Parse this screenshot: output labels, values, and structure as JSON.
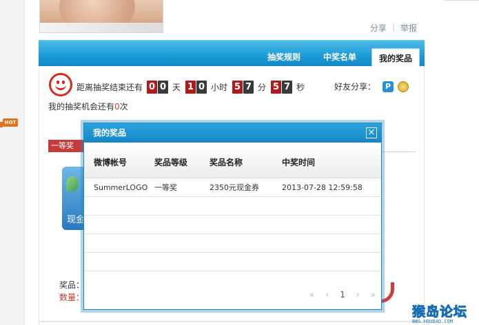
{
  "top_links": {
    "share": "分享",
    "report": "举报"
  },
  "tabs": [
    {
      "label": "抽奖规则"
    },
    {
      "label": "中奖名单"
    },
    {
      "label": "我的奖品"
    }
  ],
  "countdown": {
    "prefix": "距离抽奖结束还有",
    "days": [
      "0",
      "0"
    ],
    "days_unit": "天",
    "hours": [
      "1",
      "0"
    ],
    "hours_unit": "小时",
    "minutes": [
      "5",
      "7"
    ],
    "minutes_unit": "分",
    "seconds": [
      "5",
      "7"
    ],
    "seconds_unit": "秒"
  },
  "share": {
    "label": "好友分享：",
    "icon_p": "P"
  },
  "chance": {
    "prefix": "我的抽奖机会还有",
    "count": "0",
    "suffix": "次"
  },
  "hot_badge": "HOT",
  "prize": {
    "tag": "一等奖",
    "card_text": "现金",
    "label_prize": "奖品：",
    "label_quantity": "数量："
  },
  "modal": {
    "title": "我的奖品",
    "close": "×",
    "columns": [
      "微博帐号",
      "奖品等级",
      "奖品名称",
      "中奖时间"
    ],
    "rows": [
      {
        "account": "SummerLOGO",
        "level": "一等奖",
        "name": "2350元现金券",
        "time": "2013-07-28 12:59:58"
      }
    ],
    "pager": {
      "first": "«",
      "prev": "‹",
      "page": "1",
      "next": "›",
      "last": "»"
    }
  },
  "watermark": {
    "main": "猴岛论坛",
    "sub": "BBS.HOUDAO.COM"
  },
  "colors": {
    "accent_blue": "#1a9bd7",
    "countdown_red": "#b01a1a",
    "prize_red": "#c43c3c"
  }
}
